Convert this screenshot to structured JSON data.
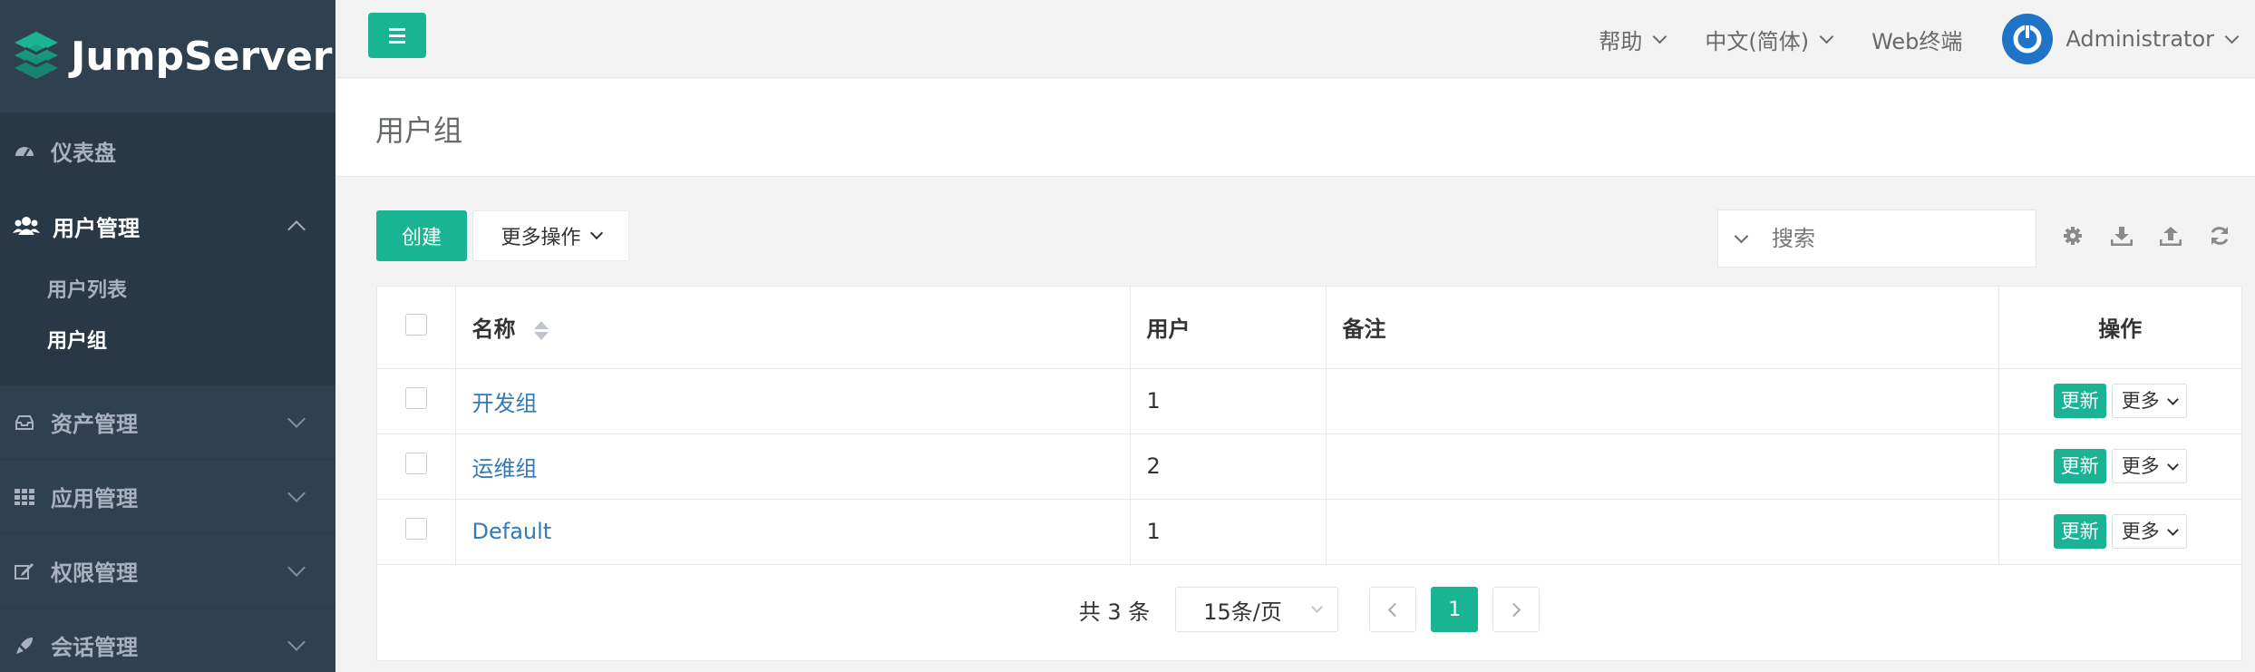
{
  "app": {
    "logo_text": "JumpServer",
    "brand_color": "#1ab394",
    "sidebar_color": "#2f4050"
  },
  "sidebar": {
    "items": [
      {
        "label": "仪表盘",
        "icon": "dashboard-icon"
      },
      {
        "label": "用户管理",
        "icon": "users-icon",
        "expanded": true,
        "children": [
          {
            "label": "用户列表"
          },
          {
            "label": "用户组",
            "current": true
          }
        ]
      },
      {
        "label": "资产管理",
        "icon": "inbox-icon"
      },
      {
        "label": "应用管理",
        "icon": "apps-grid-icon"
      },
      {
        "label": "权限管理",
        "icon": "edit-icon"
      },
      {
        "label": "会话管理",
        "icon": "rocket-icon"
      }
    ]
  },
  "topbar": {
    "help": "帮助",
    "language": "中文(简体)",
    "web_terminal": "Web终端",
    "user": "Administrator"
  },
  "page": {
    "title": "用户组"
  },
  "toolbar": {
    "create": "创建",
    "more_actions": "更多操作",
    "search_placeholder": "搜索",
    "icons": [
      "settings-icon",
      "download-icon",
      "upload-icon",
      "refresh-icon"
    ]
  },
  "table": {
    "headers": {
      "name": "名称",
      "users": "用户",
      "comment": "备注",
      "actions": "操作"
    },
    "rows": [
      {
        "name": "开发组",
        "users": "1",
        "comment": ""
      },
      {
        "name": "运维组",
        "users": "2",
        "comment": ""
      },
      {
        "name": "Default",
        "users": "1",
        "comment": ""
      }
    ],
    "update_label": "更新",
    "more_label": "更多"
  },
  "pagination": {
    "total": "共 3 条",
    "page_size": "15条/页",
    "current_page": "1"
  }
}
